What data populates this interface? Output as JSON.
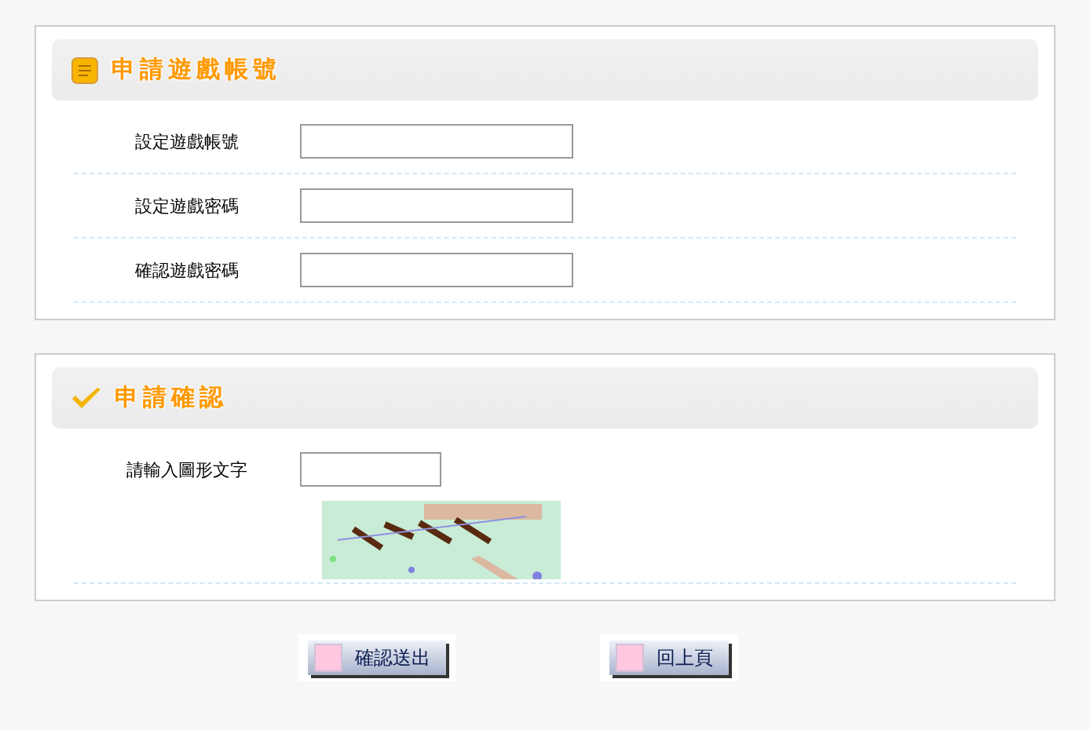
{
  "sections": [
    {
      "title": "申請遊戲帳號",
      "kind": "note",
      "fields": [
        {
          "label": "設定遊戲帳號",
          "kind": "text"
        },
        {
          "label": "設定遊戲密碼",
          "kind": "password"
        },
        {
          "label": "確認遊戲密碼",
          "kind": "password"
        }
      ]
    },
    {
      "title": "申請確認",
      "kind": "check",
      "fields": [
        {
          "label": "請輸入圖形文字",
          "kind": "captcha"
        }
      ]
    }
  ],
  "buttons": [
    "確認送出",
    "回上頁"
  ]
}
